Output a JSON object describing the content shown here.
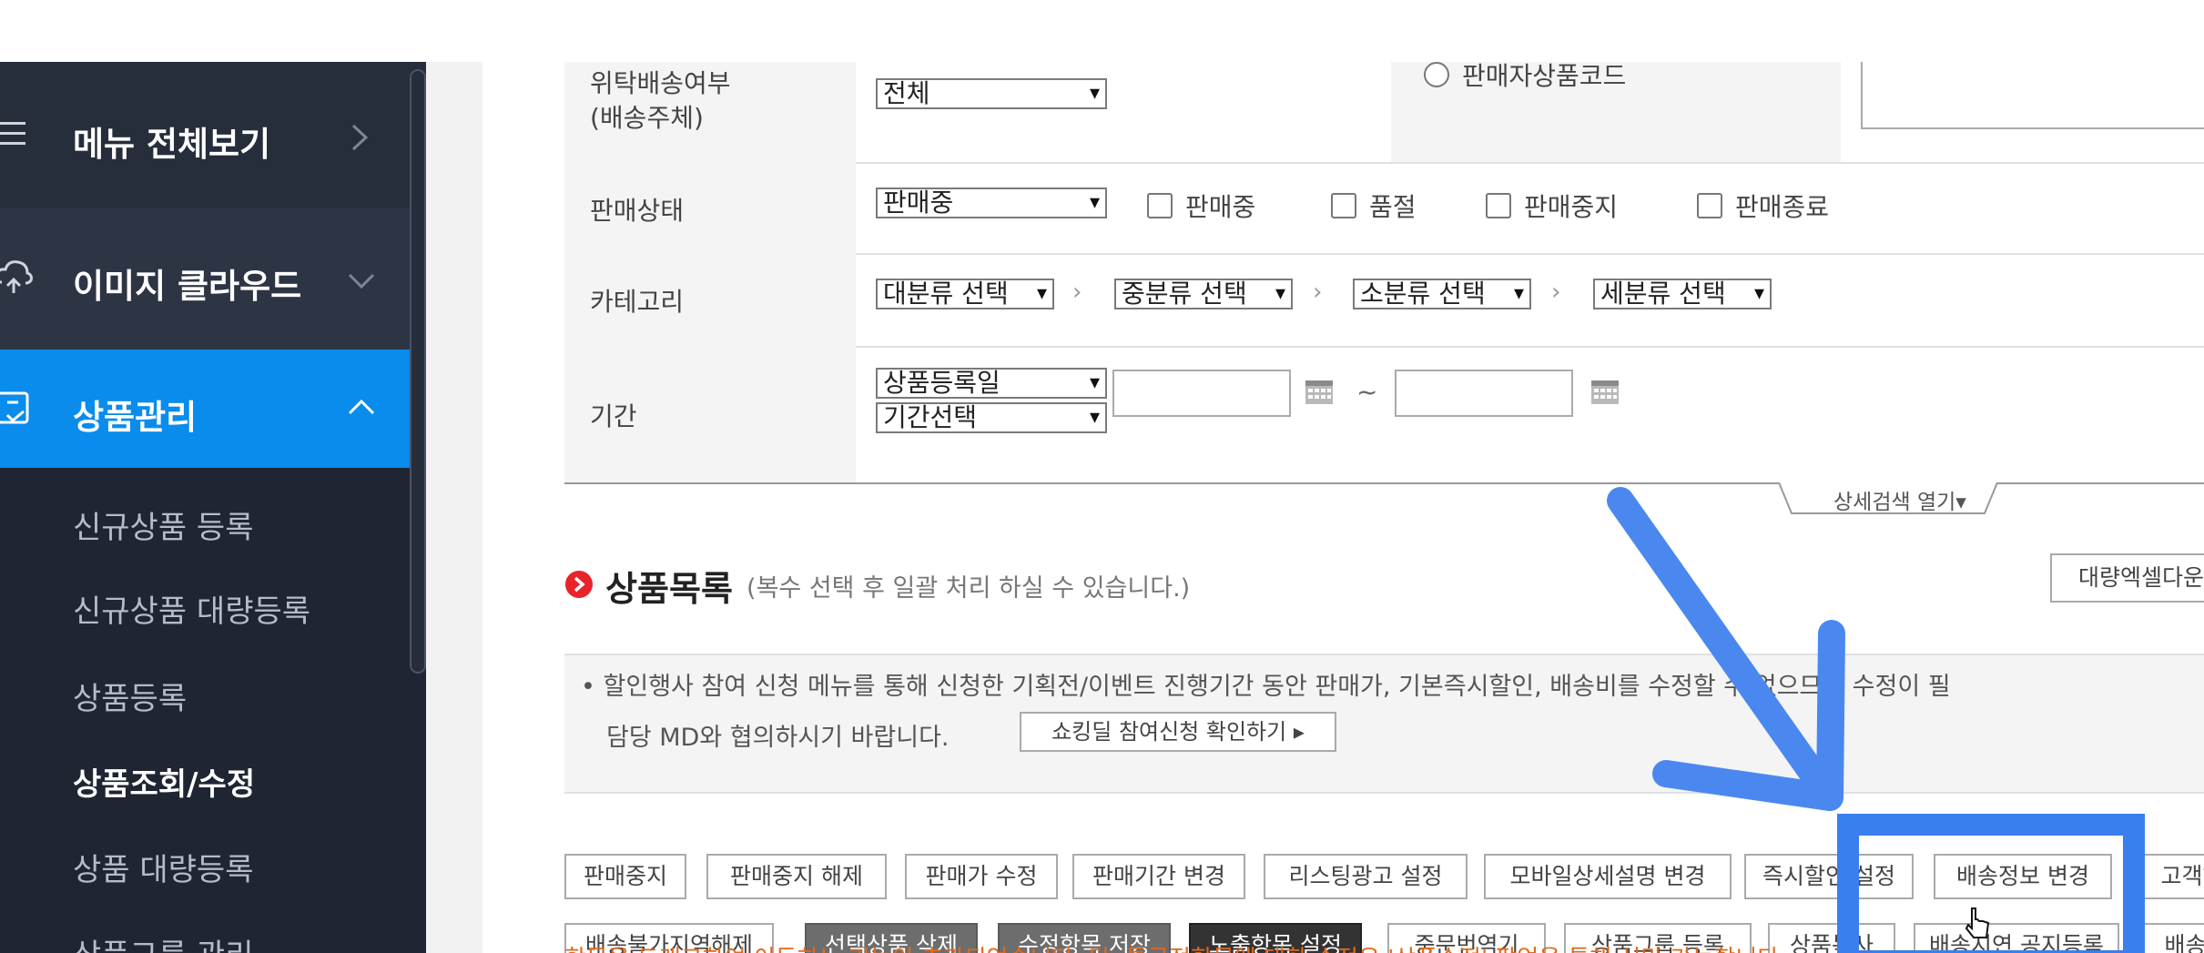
{
  "sidebar": {
    "menu_all": "메뉴 전체보기",
    "image_cloud": "이미지 클라우드",
    "product_mgmt": "상품관리",
    "sub_items": [
      "신규상품 등록",
      "신규상품 대량등록",
      "상품등록",
      "상품조회/수정",
      "상품 대량등록",
      "상품그룹 관리"
    ],
    "active_sub_index": 3,
    "colors": {
      "bg": "#262d3b",
      "active": "#0a8ced"
    }
  },
  "filters": {
    "delivery_label_1": "위탁배송여부",
    "delivery_label_2": "(배송주체)",
    "delivery_value": "전체",
    "seller_code_label": "판매자상품코드",
    "status_label": "판매상태",
    "status_value": "판매중",
    "status_checks": [
      "판매중",
      "품절",
      "판매중지",
      "판매종료"
    ],
    "category_label": "카테고리",
    "category_selects": [
      "대분류 선택",
      "중분류 선택",
      "소분류 선택",
      "세분류 선택"
    ],
    "period_label": "기간",
    "period_type": "상품등록일",
    "period_range": "기간선택",
    "range_sep": "~",
    "detail_search": "상세검색 열기▾"
  },
  "list": {
    "title": "상품목록",
    "subtitle": "(복수 선택 후 일괄 처리 하실 수 있습니다.)",
    "excel_button": "대량엑셀다운",
    "notice_1": "• 할인행사 참여 신청 메뉴를 통해 신청한 기획전/이벤트 진행기간 동안 판매가, 기본즉시할인, 배송비를 수정할 수 없으므로 수정이 필",
    "notice_2": "담당 MD와 협의하시기 바랍니다.",
    "notice_button": "쇼킹딜 참여신청 확인하기 ▸"
  },
  "buttons_row1": [
    "판매중지",
    "판매중지 해제",
    "판매가 수정",
    "판매기간 변경",
    "리스팅광고 설정",
    "모바일상세설명 변경",
    "즉시할인 설정",
    "배송정보 변경",
    "고객혜"
  ],
  "buttons_row2": [
    "배송불가지역해제",
    "선택상품 삭제",
    "수정항목 저장",
    "노출항목 설정",
    "중문번역기",
    "상품그룹 등록",
    "상품복사",
    "배송지연 공지등록",
    "배송지"
  ],
  "footer_note": "항목을 드래그하여 이동하는 기능이 추가되었습니다. 단, 특급정항목에 대한 수정은 '상품수정' 팝업을 통해 서만 가능합니다.",
  "annotation": {
    "arrow_color": "#4a88f0",
    "highlight_color": "#3a7ff0"
  }
}
